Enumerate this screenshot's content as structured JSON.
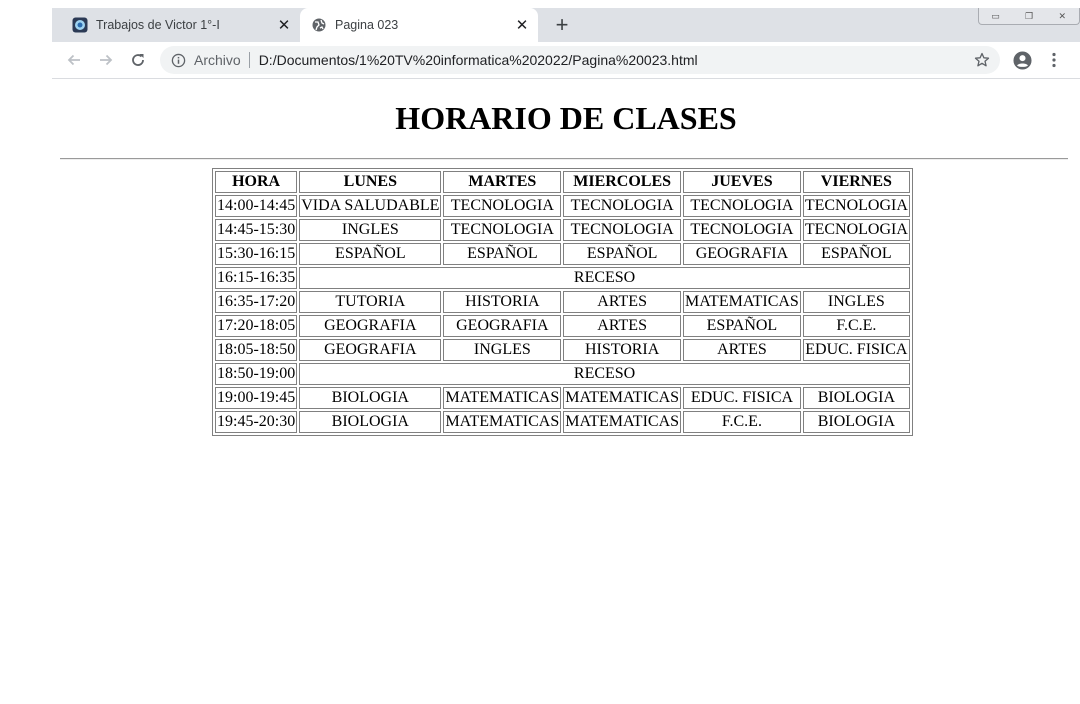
{
  "browser": {
    "tabs": [
      {
        "title": "Trabajos de Victor 1°-I",
        "icon": "site-favicon"
      },
      {
        "title": "Pagina 023",
        "icon": "globe-icon"
      }
    ],
    "new_tab_label": "+",
    "address": {
      "site_label": "Archivo",
      "url": "D:/Documentos/1%20TV%20informatica%202022/Pagina%20023.html"
    }
  },
  "page": {
    "title": "HORARIO DE CLASES",
    "schedule": {
      "headers": [
        "HORA",
        "LUNES",
        "MARTES",
        "MIERCOLES",
        "JUEVES",
        "VIERNES"
      ],
      "rows": [
        {
          "hora": "14:00-14:45",
          "cells": [
            "VIDA SALUDABLE",
            "TECNOLOGIA",
            "TECNOLOGIA",
            "TECNOLOGIA",
            "TECNOLOGIA"
          ]
        },
        {
          "hora": "14:45-15:30",
          "cells": [
            "INGLES",
            "TECNOLOGIA",
            "TECNOLOGIA",
            "TECNOLOGIA",
            "TECNOLOGIA"
          ]
        },
        {
          "hora": "15:30-16:15",
          "cells": [
            "ESPAÑOL",
            "ESPAÑOL",
            "ESPAÑOL",
            "GEOGRAFIA",
            "ESPAÑOL"
          ]
        },
        {
          "hora": "16:15-16:35",
          "cells": [
            "RECESO"
          ]
        },
        {
          "hora": "16:35-17:20",
          "cells": [
            "TUTORIA",
            "HISTORIA",
            "ARTES",
            "MATEMATICAS",
            "INGLES"
          ]
        },
        {
          "hora": "17:20-18:05",
          "cells": [
            "GEOGRAFIA",
            "GEOGRAFIA",
            "ARTES",
            "ESPAÑOL",
            "F.C.E."
          ]
        },
        {
          "hora": "18:05-18:50",
          "cells": [
            "GEOGRAFIA",
            "INGLES",
            "HISTORIA",
            "ARTES",
            "EDUC. FISICA"
          ]
        },
        {
          "hora": "18:50-19:00",
          "cells": [
            "RECESO"
          ]
        },
        {
          "hora": "19:00-19:45",
          "cells": [
            "BIOLOGIA",
            "MATEMATICAS",
            "MATEMATICAS",
            "EDUC. FISICA",
            "BIOLOGIA"
          ]
        },
        {
          "hora": "19:45-20:30",
          "cells": [
            "BIOLOGIA",
            "MATEMATICAS",
            "MATEMATICAS",
            "F.C.E.",
            "BIOLOGIA"
          ]
        }
      ]
    }
  }
}
